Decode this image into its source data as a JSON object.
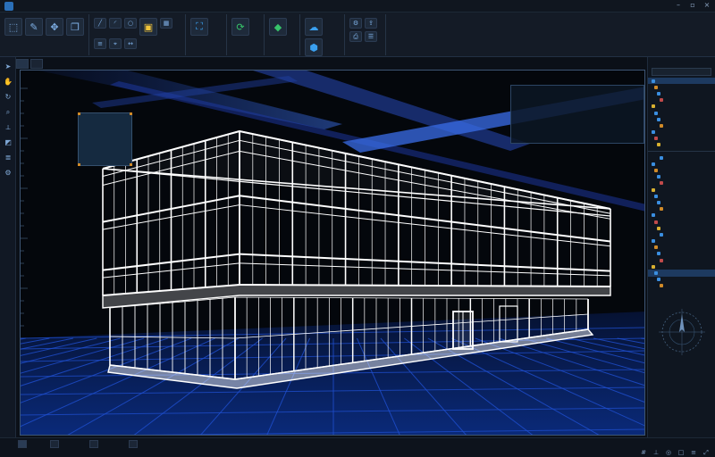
{
  "window": {
    "title": "",
    "menu": [
      "",
      "",
      "",
      "",
      "",
      "",
      "",
      "",
      "",
      "",
      "",
      "",
      "",
      ""
    ]
  },
  "ribbon": {
    "groups": [
      {
        "label": ""
      },
      {
        "label": ""
      },
      {
        "label": ""
      },
      {
        "label": ""
      },
      {
        "label": ""
      },
      {
        "label": ""
      },
      {
        "label": ""
      }
    ]
  },
  "viewport": {
    "tabs": [
      "",
      ""
    ],
    "overlay_rows": [
      "",
      "",
      "",
      "",
      "",
      "",
      "",
      "",
      ""
    ]
  },
  "model_browser": {
    "title": "",
    "items": [
      "",
      "",
      "",
      "",
      "",
      "",
      "",
      "",
      "",
      "",
      "",
      "",
      "",
      "",
      "",
      "",
      "",
      "",
      "",
      "",
      "",
      "",
      "",
      "",
      "",
      "",
      "",
      "",
      "",
      "",
      "",
      ""
    ]
  },
  "statusbar": {
    "tabs": [
      "",
      "",
      "",
      ""
    ]
  },
  "colors": {
    "accent_blue": "#3a6fd8",
    "grid_blue": "#1f4fd0",
    "wireframe": "#ffffff",
    "selection": "#1d3a60"
  },
  "icons": {
    "left_toolbar": [
      "select-icon",
      "pan-icon",
      "orbit-icon",
      "zoom-icon",
      "measure-icon",
      "section-icon",
      "layer-icon",
      "settings-icon"
    ]
  }
}
